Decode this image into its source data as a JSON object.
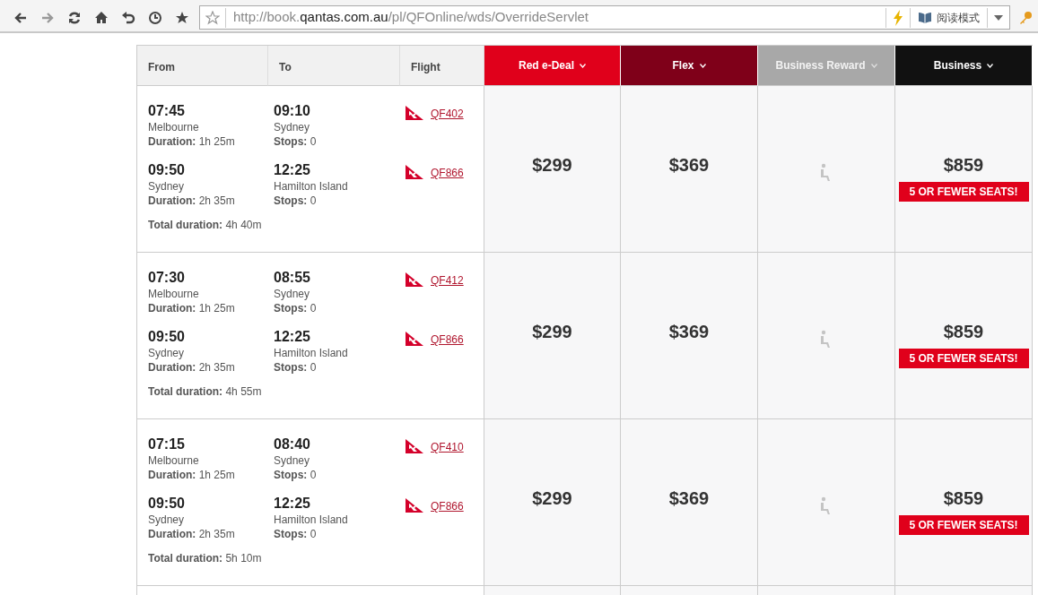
{
  "browser": {
    "url": {
      "prefix": "http://book.",
      "domain": "qantas.com.au",
      "path": "/pl/QFOnline/wds/OverrideServlet"
    },
    "reader_mode": "阅读模式"
  },
  "table": {
    "columns": [
      "From",
      "To",
      "Flight"
    ],
    "fare_columns": [
      {
        "label": "Red e-Deal",
        "color": "#e0001b",
        "disabled": false
      },
      {
        "label": "Flex",
        "color": "#7f0019",
        "disabled": false
      },
      {
        "label": "Business Reward",
        "color": "#a8a8a8",
        "disabled": true
      },
      {
        "label": "Business",
        "color": "#111111",
        "disabled": false
      }
    ],
    "rows": [
      {
        "segments": [
          {
            "dep_time": "07:45",
            "dep_city": "Melbourne",
            "duration_label": "Duration:",
            "duration": "1h 25m",
            "arr_time": "09:10",
            "arr_city": "Sydney",
            "stops_label": "Stops:",
            "stops": "0",
            "flight": "QF402"
          },
          {
            "dep_time": "09:50",
            "dep_city": "Sydney",
            "duration_label": "Duration:",
            "duration": "2h 35m",
            "arr_time": "12:25",
            "arr_city": "Hamilton Island",
            "stops_label": "Stops:",
            "stops": "0",
            "flight": "QF866"
          }
        ],
        "total_label": "Total duration:",
        "total": "4h 40m",
        "fares": [
          {
            "kind": "price",
            "price": "$299"
          },
          {
            "kind": "price",
            "price": "$369"
          },
          {
            "kind": "unavailable"
          },
          {
            "kind": "price",
            "price": "$859",
            "badge": "5 OR FEWER SEATS!"
          }
        ]
      },
      {
        "segments": [
          {
            "dep_time": "07:30",
            "dep_city": "Melbourne",
            "duration_label": "Duration:",
            "duration": "1h 25m",
            "arr_time": "08:55",
            "arr_city": "Sydney",
            "stops_label": "Stops:",
            "stops": "0",
            "flight": "QF412"
          },
          {
            "dep_time": "09:50",
            "dep_city": "Sydney",
            "duration_label": "Duration:",
            "duration": "2h 35m",
            "arr_time": "12:25",
            "arr_city": "Hamilton Island",
            "stops_label": "Stops:",
            "stops": "0",
            "flight": "QF866"
          }
        ],
        "total_label": "Total duration:",
        "total": "4h 55m",
        "fares": [
          {
            "kind": "price",
            "price": "$299"
          },
          {
            "kind": "price",
            "price": "$369"
          },
          {
            "kind": "unavailable"
          },
          {
            "kind": "price",
            "price": "$859",
            "badge": "5 OR FEWER SEATS!"
          }
        ]
      },
      {
        "segments": [
          {
            "dep_time": "07:15",
            "dep_city": "Melbourne",
            "duration_label": "Duration:",
            "duration": "1h 25m",
            "arr_time": "08:40",
            "arr_city": "Sydney",
            "stops_label": "Stops:",
            "stops": "0",
            "flight": "QF410"
          },
          {
            "dep_time": "09:50",
            "dep_city": "Sydney",
            "duration_label": "Duration:",
            "duration": "2h 35m",
            "arr_time": "12:25",
            "arr_city": "Hamilton Island",
            "stops_label": "Stops:",
            "stops": "0",
            "flight": "QF866"
          }
        ],
        "total_label": "Total duration:",
        "total": "5h 10m",
        "fares": [
          {
            "kind": "price",
            "price": "$299"
          },
          {
            "kind": "price",
            "price": "$369"
          },
          {
            "kind": "unavailable"
          },
          {
            "kind": "price",
            "price": "$859",
            "badge": "5 OR FEWER SEATS!"
          }
        ]
      }
    ]
  }
}
